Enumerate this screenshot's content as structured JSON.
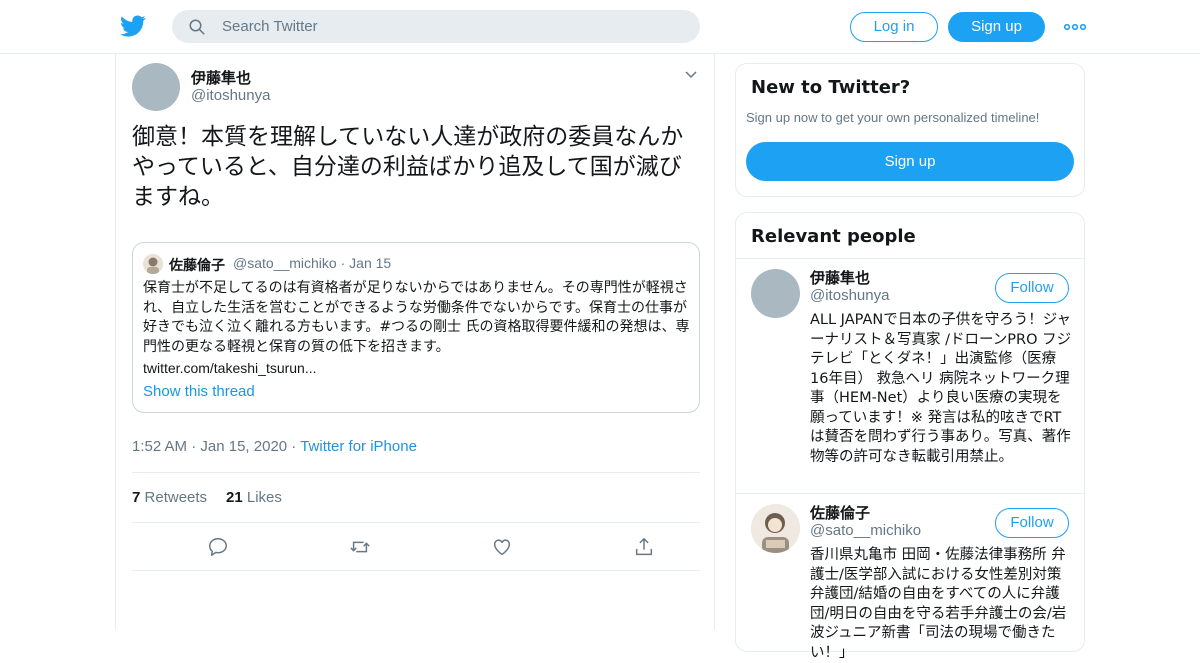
{
  "header": {
    "search_placeholder": "Search Twitter",
    "login_label": "Log in",
    "signup_label": "Sign up",
    "brand_color": "#1da1f2"
  },
  "tweet": {
    "author_name": "伊藤隼也",
    "author_handle": "@itoshunya",
    "text": "御意！本質を理解していない人達が政府の委員なんかやっていると、自分達の利益ばかり追及して国が滅びますね。",
    "time": "1:52 AM",
    "date": "Jan 15, 2020",
    "source": "Twitter for iPhone",
    "retweets_count": "7",
    "retweets_label": "Retweets",
    "likes_count": "21",
    "likes_label": "Likes"
  },
  "quoted": {
    "name": "佐藤倫子",
    "handle": "@sato__michiko",
    "date": "Jan 15",
    "text": "保育士が不足してるのは有資格者が足りないからではありません。その専門性が軽視され、自立した生活を営むことができるような労働条件でないからです。保育士の仕事が好きでも泣く泣く離れる方もいます。#つるの剛士 氏の資格取得要件緩和の発想は、専門性の更なる軽視と保育の質の低下を招きます。",
    "link": "twitter.com/takeshi_tsurun...",
    "show_thread": "Show this thread"
  },
  "signup_box": {
    "title": "New to Twitter?",
    "subtitle": "Sign up now to get your own personalized timeline!",
    "button": "Sign up"
  },
  "relevant": {
    "title": "Relevant people",
    "people": [
      {
        "name": "伊藤隼也",
        "handle": "@itoshunya",
        "follow": "Follow",
        "bio": "ALL JAPANで日本の子供を守ろう！ジャーナリスト＆写真家 /ドローンPRO フジテレビ「とくダネ！」出演監修（医療 16年目） 救急ヘリ 病院ネットワーク理事（HEM-Net）より良い医療の実現を願っています！※ 発言は私的呟きでRTは賛否を問わず行う事あり。写真、著作物等の許可なき転載引用禁止。"
      },
      {
        "name": "佐藤倫子",
        "handle": "@sato__michiko",
        "follow": "Follow",
        "bio": "香川県丸亀市 田岡・佐藤法律事務所 弁護士/医学部入試における女性差別対策弁護団/結婚の自由をすべての人に弁護団/明日の自由を守る若手弁護士の会/岩波ジュニア新書「司法の現場で働きたい！」"
      }
    ]
  }
}
